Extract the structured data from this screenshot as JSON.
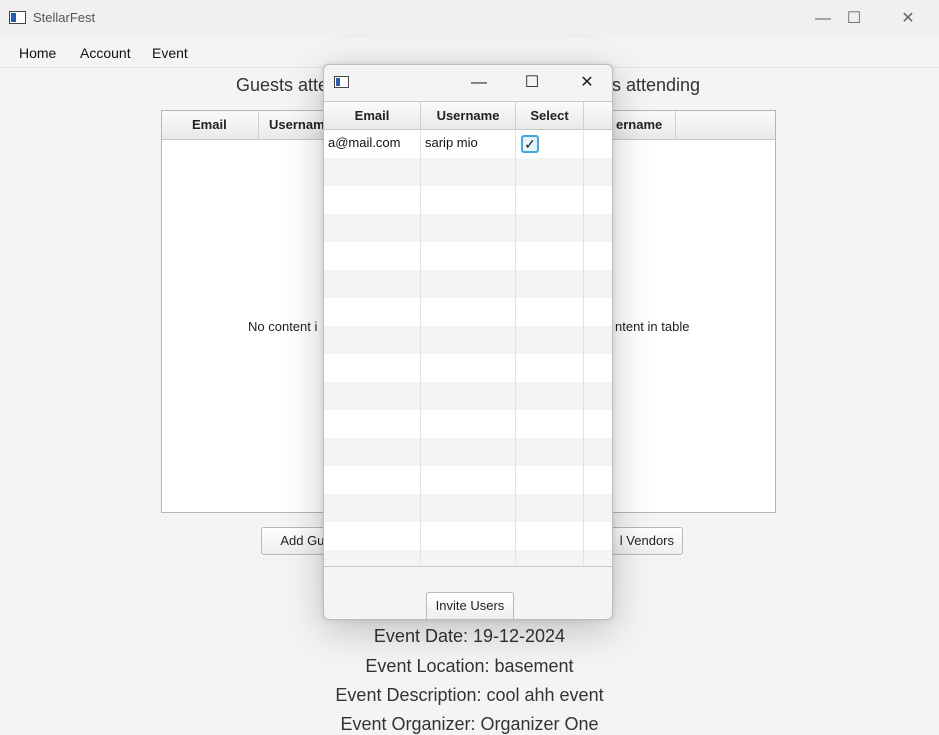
{
  "window": {
    "title": "StellarFest",
    "controls": {
      "minimize": "—",
      "maximize": "☐",
      "close": "✕"
    }
  },
  "menu": {
    "items": [
      "Home",
      "Account",
      "Event"
    ]
  },
  "main": {
    "guests_heading": "Guests atte",
    "vendors_heading": "s attending",
    "guests_table": {
      "columns": [
        "Email",
        "Usernam"
      ],
      "placeholder": "No content i"
    },
    "vendors_table": {
      "columns": [
        "ername"
      ],
      "placeholder": "ntent in table"
    },
    "add_guests_label": "Add Gue",
    "add_vendors_label": "l Vendors",
    "event_info": {
      "date": "Event Date: 19-12-2024",
      "location": "Event Location: basement",
      "description": "Event Description: cool ahh event",
      "organizer": "Event Organizer: Organizer One"
    }
  },
  "dialog": {
    "controls": {
      "minimize": "—",
      "maximize": "☐",
      "close": "✕"
    },
    "columns": [
      "Email",
      "Username",
      "Select",
      ""
    ],
    "rows": [
      {
        "email": "a@mail.com",
        "username": "sarip mio",
        "selected": true
      }
    ],
    "invite_label": "Invite Users"
  }
}
